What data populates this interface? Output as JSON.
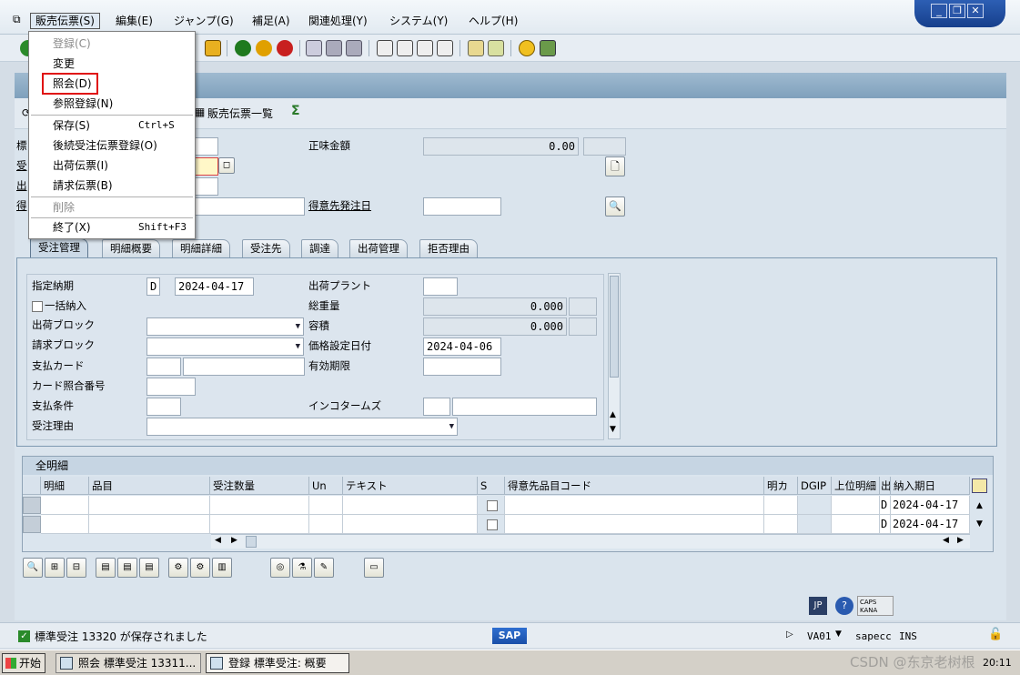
{
  "menubar": {
    "items": [
      "販売伝票(S)",
      "編集(E)",
      "ジャンプ(G)",
      "補足(A)",
      "関連処理(Y)",
      "システム(Y)",
      "ヘルプ(H)"
    ]
  },
  "dropdown": {
    "items": [
      {
        "label": "登録(C)",
        "shortcut": "",
        "disabled": true
      },
      {
        "label": "変更",
        "shortcut": "",
        "disabled": false
      },
      {
        "label": "照会(D)",
        "shortcut": "",
        "disabled": false
      },
      {
        "label": "参照登録(N)",
        "shortcut": "",
        "disabled": false
      },
      {
        "label": "保存(S)",
        "shortcut": "Ctrl+S",
        "disabled": false
      },
      {
        "label": "後続受注伝票登録(O)",
        "shortcut": "",
        "disabled": false
      },
      {
        "label": "出荷伝票(I)",
        "shortcut": "",
        "disabled": false
      },
      {
        "label": "請求伝票(B)",
        "shortcut": "",
        "disabled": false
      },
      {
        "label": "削除",
        "shortcut": "",
        "disabled": true
      },
      {
        "label": "終了(X)",
        "shortcut": "Shift+F3",
        "disabled": false
      }
    ]
  },
  "appbar": {
    "sales_list": "販売伝票一覧"
  },
  "header": {
    "net_value_label": "正味金額",
    "net_value": "0.00",
    "po_date_label": "得意先発注日",
    "left_labels": [
      "標",
      "受",
      "出",
      "得"
    ]
  },
  "tabs": [
    "受注管理",
    "明細概要",
    "明細詳細",
    "受注先",
    "調達",
    "出荷管理",
    "拒否理由"
  ],
  "form": {
    "req_delivery_label": "指定納期",
    "req_delivery_type": "D",
    "req_delivery_date": "2024-04-17",
    "complete_delivery_label": "一括納入",
    "delivery_block_label": "出荷ブロック",
    "billing_block_label": "請求ブロック",
    "payment_card_label": "支払カード",
    "card_verification_label": "カード照合番号",
    "payment_terms_label": "支払条件",
    "order_reason_label": "受注理由",
    "delivering_plant_label": "出荷プラント",
    "total_weight_label": "総重量",
    "total_weight": "0.000",
    "volume_label": "容積",
    "volume": "0.000",
    "pricing_date_label": "価格設定日付",
    "pricing_date": "2024-04-06",
    "valid_until_label": "有効期限",
    "incoterms_label": "インコタームズ"
  },
  "table": {
    "title": "全明細",
    "columns": [
      "明細",
      "品目",
      "受注数量",
      "Un",
      "テキスト",
      "S",
      "得意先品目コード",
      "明カ",
      "DGIP",
      "上位明細",
      "出",
      "納入期日"
    ],
    "rows": [
      {
        "type": "D",
        "date": "2024-04-17"
      },
      {
        "type": "D",
        "date": "2024-04-17"
      }
    ]
  },
  "status": {
    "message": "標準受注 13320 が保存されました",
    "transaction": "VA01",
    "server": "sapecc",
    "mode": "INS",
    "caps": "CAPS",
    "kana": "KANA",
    "jp": "JP",
    "sap": "SAP"
  },
  "taskbar": {
    "start": "开始",
    "tasks": [
      "照会 標準受注 13311...",
      "登録 標準受注: 概要"
    ],
    "clock": "20:11",
    "watermark": "CSDN @东京老树根"
  }
}
